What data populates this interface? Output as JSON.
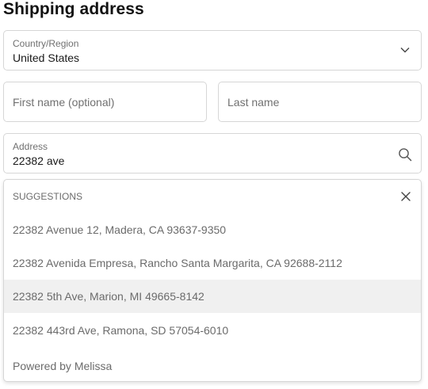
{
  "page": {
    "title": "Shipping address"
  },
  "country": {
    "label": "Country/Region",
    "value": "United States",
    "icon": "chevron-down-icon"
  },
  "first_name": {
    "placeholder": "First name (optional)"
  },
  "last_name": {
    "placeholder": "Last name"
  },
  "address": {
    "label": "Address",
    "value": "22382 ave",
    "icon": "search-icon"
  },
  "suggestions": {
    "header": "SUGGESTIONS",
    "close_icon": "close-icon",
    "items": [
      {
        "label": "22382 Avenue 12, Madera, CA 93637-9350"
      },
      {
        "label": "22382 Avenida Empresa, Rancho Santa Margarita, CA 92688-2112"
      },
      {
        "label": "22382 5th Ave, Marion, MI 49665-8142"
      },
      {
        "label": "22382 443rd Ave, Ramona, SD 57054-6010"
      }
    ],
    "highlighted_index": 2,
    "footer": "Powered by Melissa"
  }
}
